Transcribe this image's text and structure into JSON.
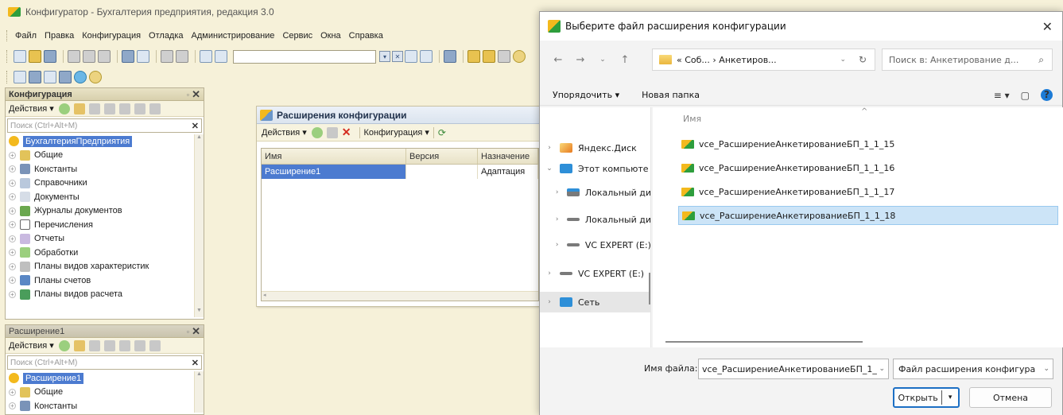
{
  "app": {
    "title": "Конфигуратор - Бухгалтерия предприятия, редакция 3.0",
    "menu": [
      "Файл",
      "Правка",
      "Конфигурация",
      "Отладка",
      "Администрирование",
      "Сервис",
      "Окна",
      "Справка"
    ]
  },
  "config_panel": {
    "title": "Конфигурация",
    "actions_label": "Действия ▾",
    "search_placeholder": "Поиск (Ctrl+Alt+M)",
    "root": "БухгалтерияПредприятия",
    "items": [
      "Общие",
      "Константы",
      "Справочники",
      "Документы",
      "Журналы документов",
      "Перечисления",
      "Отчеты",
      "Обработки",
      "Планы видов характеристик",
      "Планы счетов",
      "Планы видов расчета"
    ]
  },
  "ext_panel": {
    "title": "Расширение1",
    "actions_label": "Действия ▾",
    "search_placeholder": "Поиск (Ctrl+Alt+M)",
    "root": "Расширение1",
    "items": [
      "Общие",
      "Константы"
    ]
  },
  "ext_window": {
    "title": "Расширения конфигурации",
    "actions_label": "Действия ▾",
    "config_label": "Конфигурация ▾",
    "columns": [
      "Имя",
      "Версия",
      "Назначение"
    ],
    "rows": [
      {
        "name": "Расширение1",
        "version": "",
        "purpose": "Адаптация"
      }
    ]
  },
  "dialog": {
    "title": "Выберите файл расширения конфигурации",
    "address": "« Соб... › Анкетиров...",
    "search_placeholder": "Поиск в: Анкетирование д...",
    "organize": "Упорядочить ▾",
    "new_folder": "Новая папка",
    "nav_items": [
      {
        "label": "Яндекс.Диск",
        "chevron": "›"
      },
      {
        "label": "Этот компьюте",
        "chevron": "⌄"
      },
      {
        "label": "Локальный ди",
        "chevron": "›"
      },
      {
        "label": "Локальный ди",
        "chevron": "›"
      },
      {
        "label": "VC EXPERT (E:)",
        "chevron": "›"
      },
      {
        "label": "VC EXPERT (E:)",
        "chevron": "›"
      },
      {
        "label": "Сеть",
        "chevron": "›"
      }
    ],
    "column_name": "Имя",
    "files": [
      "vce_РасширениеАнкетированиеБП_1_1_15",
      "vce_РасширениеАнкетированиеБП_1_1_16",
      "vce_РасширениеАнкетированиеБП_1_1_17",
      "vce_РасширениеАнкетированиеБП_1_1_18"
    ],
    "selected_index": 3,
    "filename_label": "Имя файла:",
    "filename_value": "vce_РасширениеАнкетированиеБП_1_",
    "filetype": "Файл расширения конфигура",
    "open_label": "Открыть",
    "cancel_label": "Отмена"
  }
}
